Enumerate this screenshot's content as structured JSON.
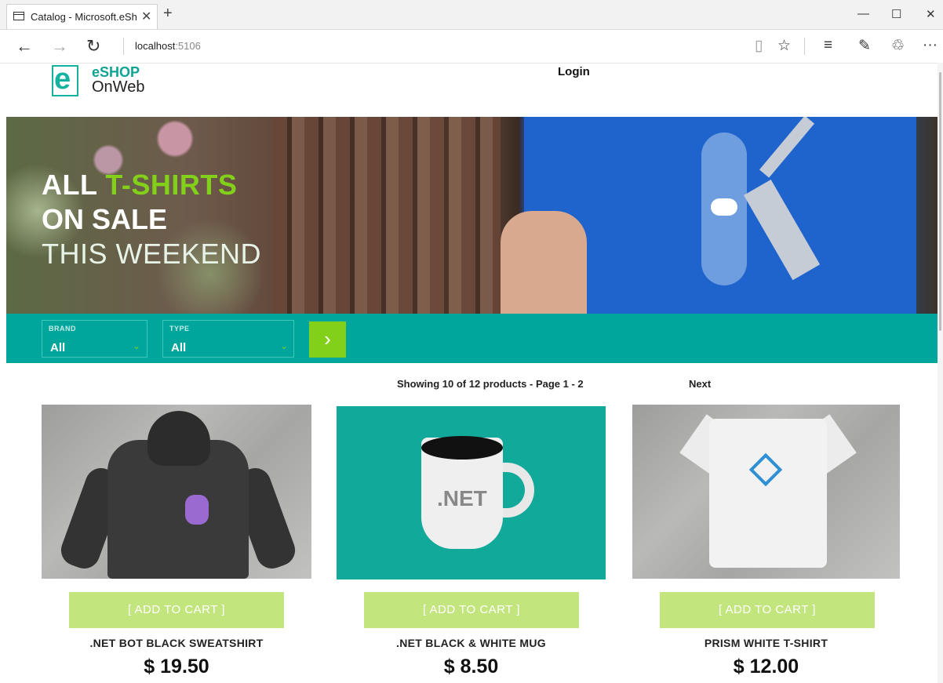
{
  "browser": {
    "tab_title": "Catalog - Microsoft.eSh",
    "tab_close": "✕",
    "new_tab": "+",
    "window": {
      "minimize": "—",
      "maximize": "☐",
      "close": "✕"
    },
    "url_host": "localhost",
    "url_port": ":5106",
    "nav": {
      "back": "←",
      "forward": "→",
      "refresh": "↻"
    },
    "toolbar_icons": {
      "reading_view": "▯",
      "favorite": "☆",
      "hub": "≡",
      "notes": "✎",
      "share": "♲",
      "more": "···"
    }
  },
  "header": {
    "logo_shop": "eSHOP",
    "logo_onweb": "OnWeb",
    "logo_letter": "e",
    "login": "Login"
  },
  "hero": {
    "line1_white": "ALL",
    "line1_green": "T-SHIRTS",
    "line2": "ON SALE",
    "line3": "THIS WEEKEND"
  },
  "filters": {
    "brand_label": "BRAND",
    "brand_value": "All",
    "type_label": "TYPE",
    "type_value": "All",
    "chevron": "⌄",
    "apply": "›"
  },
  "pager": {
    "summary": "Showing 10 of 12 products - Page 1 - 2",
    "next": "Next"
  },
  "products": [
    {
      "name": ".NET BOT BLACK SWEATSHIRT",
      "price": "$ 19.50",
      "cart": "[ ADD TO CART ]"
    },
    {
      "name": ".NET BLACK & WHITE MUG",
      "price": "$ 8.50",
      "cart": "[ ADD TO CART ]",
      "mug_text": ".NET"
    },
    {
      "name": "PRISM WHITE T-SHIRT",
      "price": "$ 12.00",
      "cart": "[ ADD TO CART ]"
    }
  ],
  "colors": {
    "teal": "#00a69c",
    "green": "#83d01b",
    "cart_button": "#c2e57e"
  }
}
